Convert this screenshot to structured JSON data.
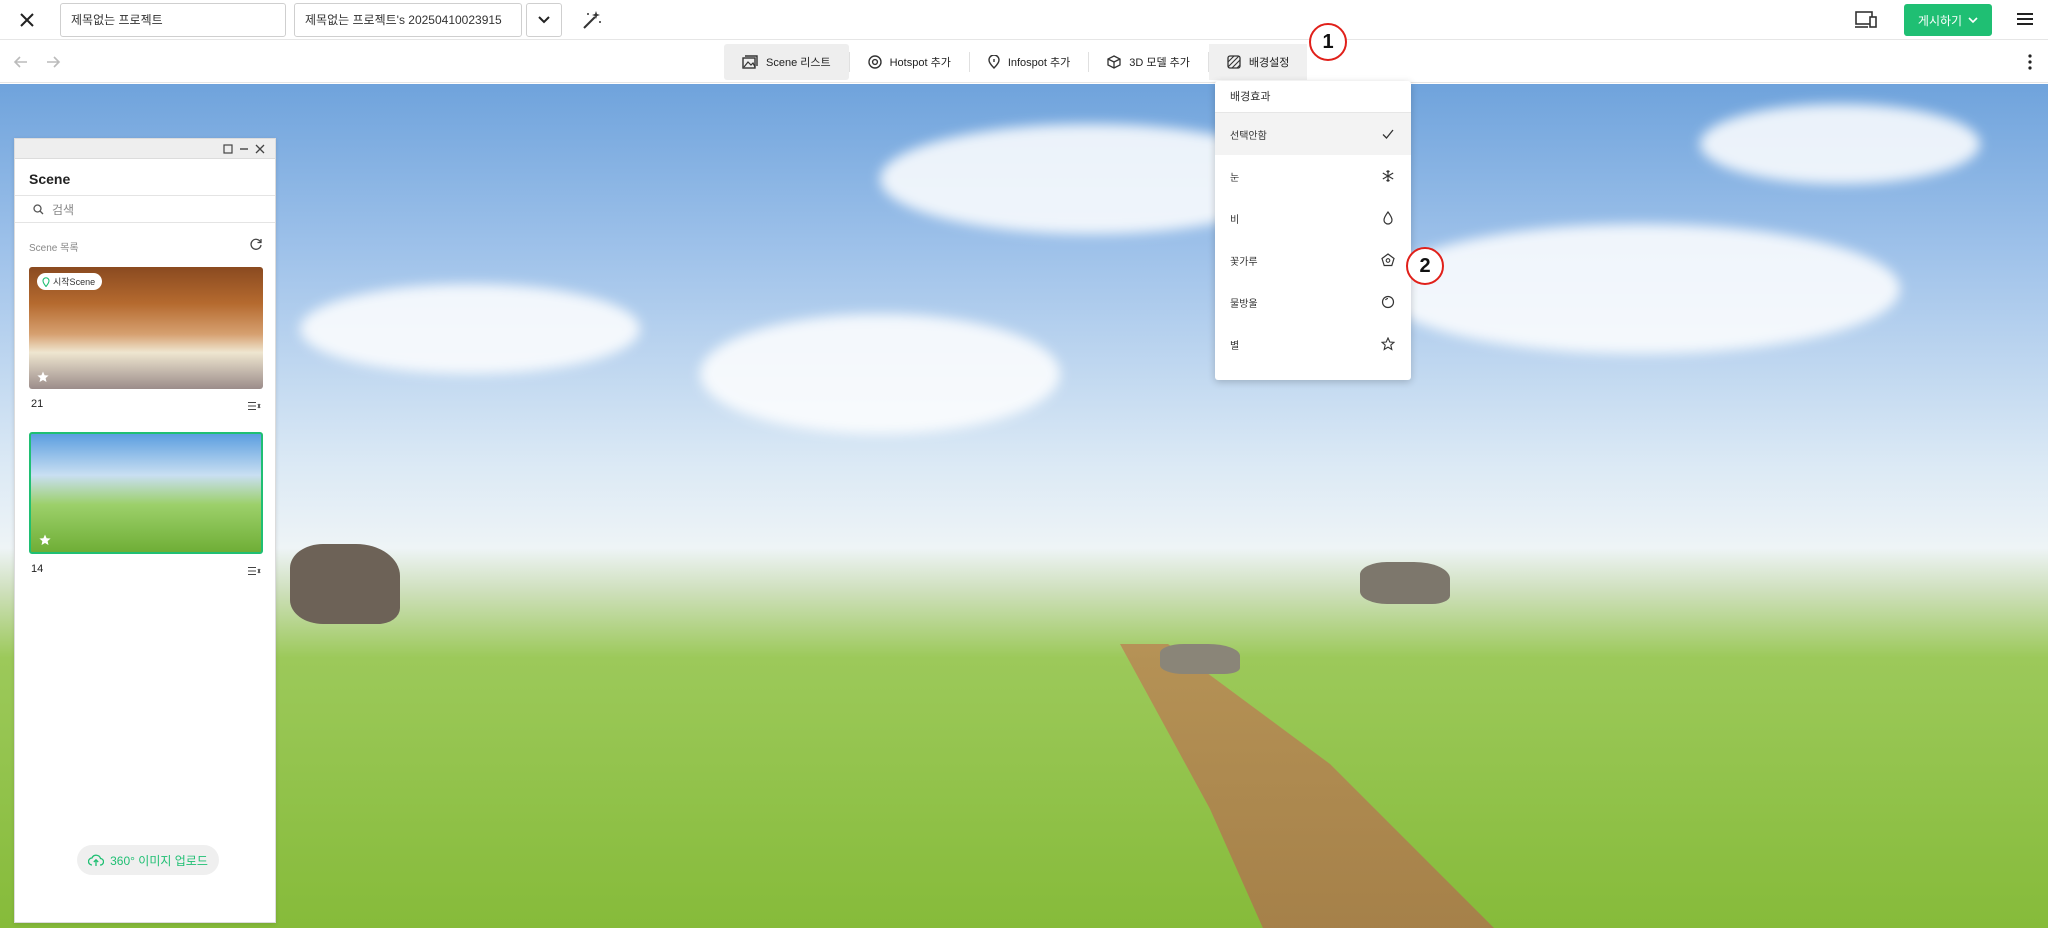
{
  "topbar": {
    "project_name": "제목없는 프로젝트",
    "version_name": "제목없는 프로젝트's 20250410023915",
    "publish_label": "게시하기"
  },
  "toolbar": {
    "tabs": [
      {
        "label": "Scene 리스트",
        "icon": "scene-list-icon"
      },
      {
        "label": "Hotspot 추가",
        "icon": "hotspot-icon"
      },
      {
        "label": "Infospot 추가",
        "icon": "infospot-icon"
      },
      {
        "label": "3D 모델 추가",
        "icon": "cube-icon"
      },
      {
        "label": "배경설정",
        "icon": "background-icon"
      }
    ]
  },
  "scene_panel": {
    "title": "Scene",
    "search_placeholder": "검색",
    "list_label": "Scene 목록",
    "start_badge": "시작Scene",
    "scenes": [
      {
        "num": "21"
      },
      {
        "num": "14"
      }
    ],
    "upload_label": "360° 이미지 업로드"
  },
  "effects_menu": {
    "header": "배경효과",
    "items": [
      {
        "label": "선택안함",
        "icon": "check-icon",
        "selected": true
      },
      {
        "label": "눈",
        "icon": "snowflake-icon"
      },
      {
        "label": "비",
        "icon": "droplet-icon"
      },
      {
        "label": "꽃가루",
        "icon": "pentagon-flower-icon"
      },
      {
        "label": "물방울",
        "icon": "bubble-icon"
      },
      {
        "label": "별",
        "icon": "star-icon"
      }
    ]
  },
  "annotations": [
    "1",
    "2"
  ],
  "colors": {
    "accent": "#1fbf73",
    "annotation": "#e0201a"
  }
}
